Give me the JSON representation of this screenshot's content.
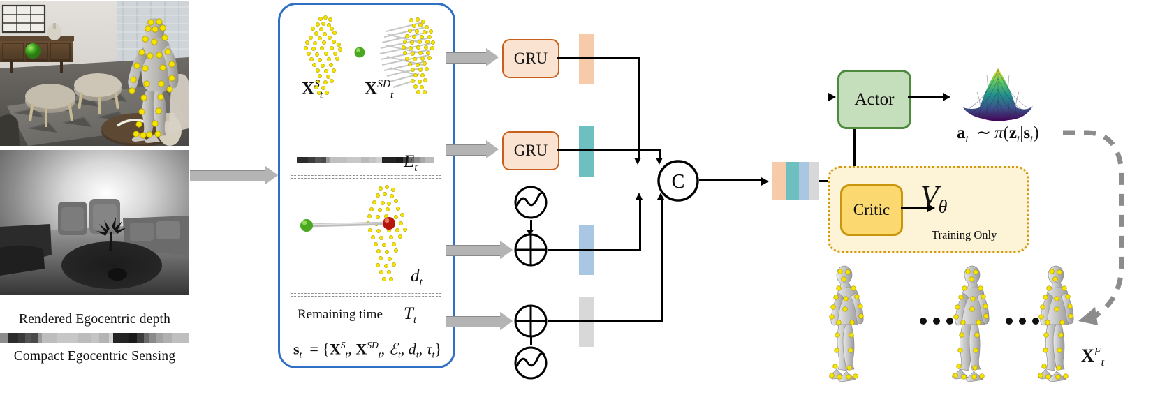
{
  "figure": {
    "domain": "diagram",
    "title": "Egocentric sensing actor-critic policy pipeline"
  },
  "left_panel": {
    "rgb_view": {
      "name": "rendered-egocentric-rgb-scene",
      "description": "Indoor living room with skinned human mesh and yellow joint markers, green target ball on sideboard, two ottomans"
    },
    "depth_view": {
      "name": "rendered-egocentric-depth",
      "caption": "Rendered Egocentric depth"
    },
    "sensing_strip": {
      "caption": "Compact Egocentric Sensing"
    }
  },
  "state_box": {
    "panels": [
      {
        "id": "point-clouds",
        "labels": [
          "X_t^S",
          "X_t^{SD}"
        ],
        "label_base_1": "X",
        "label_sup_1": "S",
        "label_sub_1": "t",
        "label_base_2": "X",
        "label_sup_2": "SD",
        "label_sub_2": "t"
      },
      {
        "id": "compact-sensing",
        "label_base": "E",
        "label_sub": "t"
      },
      {
        "id": "distance",
        "label_base": "d",
        "label_sub": "t"
      },
      {
        "id": "remaining-time",
        "text": "Remaining time",
        "label_base": "T",
        "label_sub": "t"
      }
    ],
    "equation": {
      "lhs_base": "s",
      "lhs_sub": "t",
      "full": "s_t = { X_t^S , X_t^{SD} , E_t , d_t , tau_t }"
    }
  },
  "encoders": {
    "gru_top": {
      "label": "GRU"
    },
    "gru_mid": {
      "label": "GRU"
    },
    "sinusoid_top": {
      "name": "sinusoidal-positional-encoding"
    },
    "sinusoid_bottom": {
      "name": "sinusoidal-positional-encoding"
    },
    "add_distance": {
      "symbol": "+"
    },
    "add_time": {
      "symbol": "+"
    },
    "concat": {
      "symbol": "C"
    }
  },
  "colors": {
    "feature_peach": "#f7cba9",
    "feature_teal": "#6ec0c0",
    "feature_blue": "#a9c6e2",
    "feature_gray": "#d8d8d8",
    "gru_fill": "#fbe3d2",
    "gru_border": "#c8601c",
    "actor_fill": "#c5debb",
    "actor_border": "#4e8a3e",
    "critic_fill": "#fbd970",
    "critic_border": "#c8960c",
    "critic_region_fill": "#fdf3d6",
    "critic_region_border": "#d39a10",
    "state_box_border": "#2f6fc4",
    "joint_yellow": "#f3e600",
    "target_green": "#3c9d1e",
    "target_red": "#c0160d",
    "arrow_gray": "#b4b4b4",
    "feedback_dash": "#8c8c8c"
  },
  "feature_bars": {
    "top": {
      "name": "pointcloud-feature-vector",
      "color": "#f7cba9"
    },
    "mid": {
      "name": "sensing-feature-vector",
      "color": "#6ec0c0"
    },
    "dist": {
      "name": "distance-feature-vector",
      "color": "#a9c6e2"
    },
    "time": {
      "name": "time-feature-vector",
      "color": "#d8d8d8"
    },
    "concat_segments": [
      "#f7cba9",
      "#6ec0c0",
      "#a9c6e2",
      "#d8d8d8"
    ]
  },
  "heads": {
    "actor": {
      "label": "Actor"
    },
    "critic": {
      "label": "Critic"
    },
    "value_symbol": {
      "base": "V",
      "sub": "θ"
    },
    "training_only": "Training Only",
    "policy_distribution": {
      "name": "gaussian-policy-surface-plot",
      "colormap": "viridis"
    },
    "action_formula": {
      "text": "a_t ~ π(z_t | s_t)",
      "a_base": "a",
      "a_sub": "t",
      "tilde": "∼",
      "pi": "π",
      "z_base": "z",
      "z_sub": "t",
      "bar": "|",
      "s_base": "s",
      "s_sub": "t"
    }
  },
  "rollout": {
    "name": "generated-motion-sequence",
    "frames": 3,
    "ellipsis": "...",
    "label_base": "X",
    "label_sup": "F",
    "label_sub": "t"
  }
}
